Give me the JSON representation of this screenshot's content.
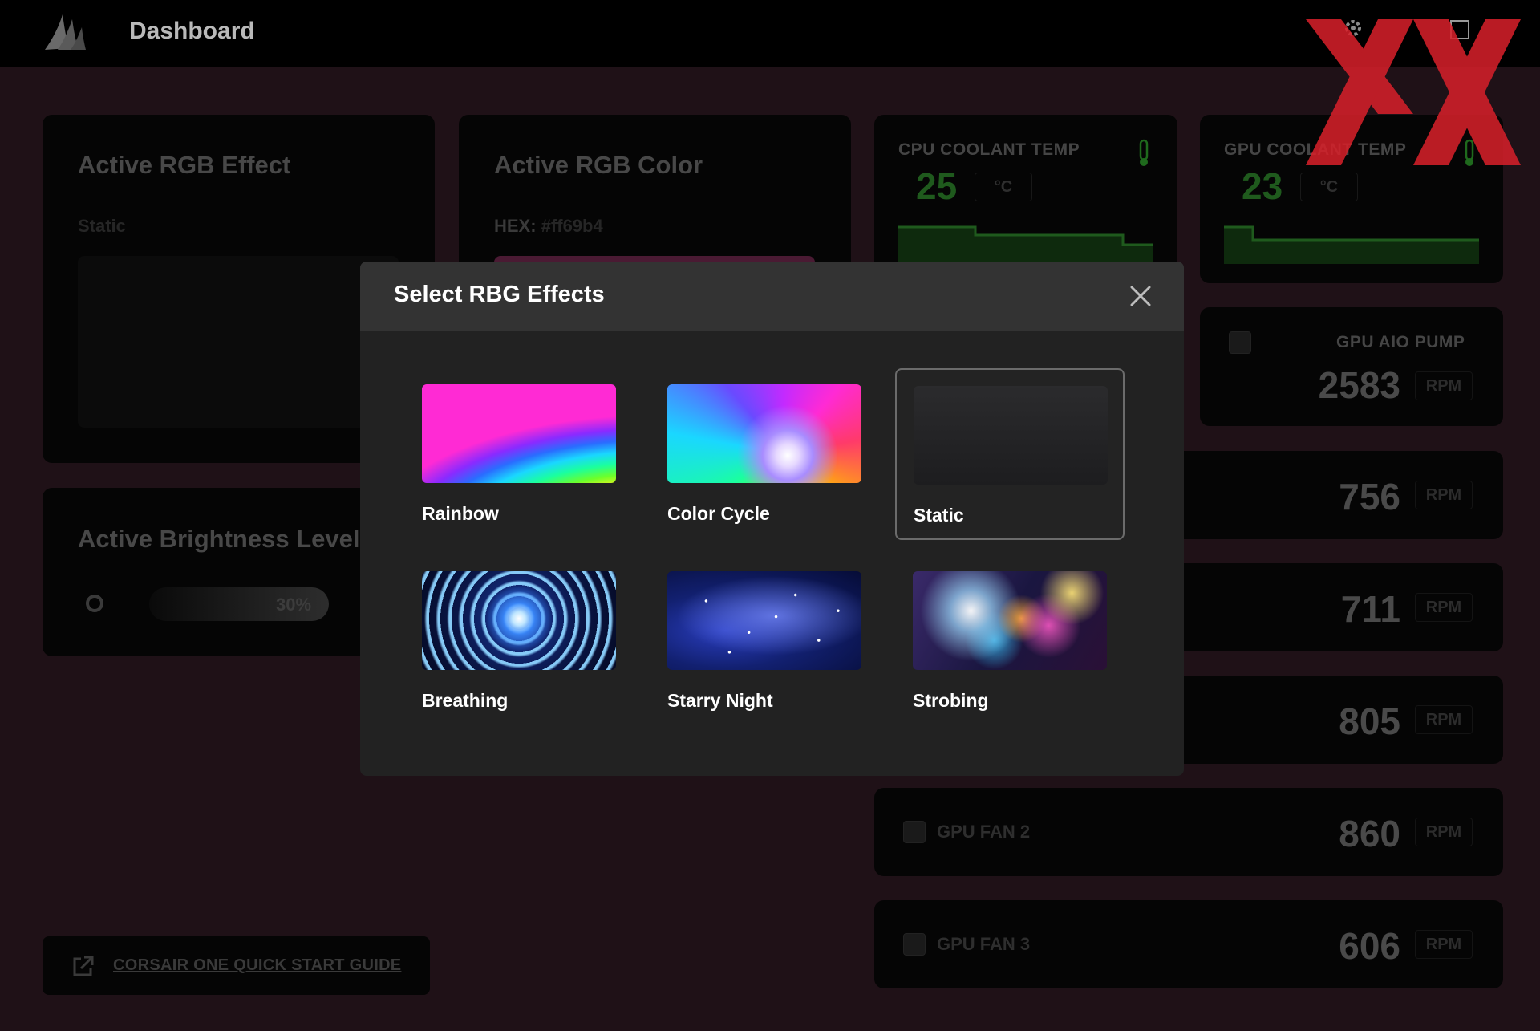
{
  "app": {
    "title": "Dashboard"
  },
  "cards": {
    "rgb_effect": {
      "title": "Active RGB Effect",
      "value": "Static"
    },
    "rgb_color": {
      "title": "Active RGB Color",
      "hex_label": "HEX:",
      "hex_value": "#ff69b4"
    },
    "brightness": {
      "title": "Active Brightness Level",
      "value_text": "30%",
      "level_percent": 30
    }
  },
  "sensors": {
    "cpu_coolant": {
      "label": "CPU COOLANT TEMP",
      "value": "25",
      "unit": "°C"
    },
    "gpu_coolant": {
      "label": "GPU COOLANT TEMP",
      "value": "23",
      "unit": "°C"
    }
  },
  "fans": [
    {
      "name": "GPU AIO PUMP",
      "value": "2583",
      "unit": "RPM"
    },
    {
      "name": "",
      "value": "756",
      "unit": "RPM"
    },
    {
      "name": "",
      "value": "711",
      "unit": "RPM"
    },
    {
      "name": "",
      "value": "805",
      "unit": "RPM"
    },
    {
      "name": "GPU FAN 2",
      "value": "860",
      "unit": "RPM"
    },
    {
      "name": "GPU FAN 3",
      "value": "606",
      "unit": "RPM"
    }
  ],
  "guide_link": "CORSAIR ONE QUICK START GUIDE",
  "modal": {
    "title": "Select RBG Effects",
    "effects": [
      {
        "label": "Rainbow",
        "thumb": "rainbow"
      },
      {
        "label": "Color Cycle",
        "thumb": "color-cycle"
      },
      {
        "label": "Static",
        "thumb": "static",
        "selected": true
      },
      {
        "label": "Breathing",
        "thumb": "breathing"
      },
      {
        "label": "Starry Night",
        "thumb": "starry-night"
      },
      {
        "label": "Strobing",
        "thumb": "strobing"
      }
    ]
  },
  "colors": {
    "background": "#1f1117",
    "modal_bg": "#222222",
    "modal_header": "#333333",
    "temp_green": "#1f5a1d",
    "watermark_red": "#d8202a"
  },
  "icons": {
    "logo": "corsair-sails-icon",
    "close": "close-icon",
    "thermometer": "thermometer-icon",
    "fan": "fan-icon",
    "external_link": "external-link-icon"
  }
}
